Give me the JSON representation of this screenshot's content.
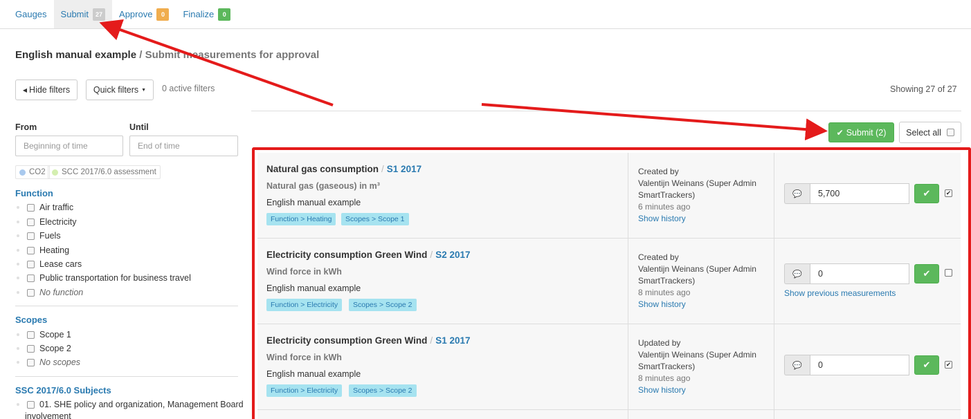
{
  "tabs": [
    {
      "label": "Gauges",
      "badge": ""
    },
    {
      "label": "Submit",
      "badge": "27",
      "badge_color": "#cccccc"
    },
    {
      "label": "Approve",
      "badge": "0",
      "badge_color": "#f0ad4e"
    },
    {
      "label": "Finalize",
      "badge": "0",
      "badge_color": "#5cb85c"
    }
  ],
  "page": {
    "title": "English manual example",
    "subtitle": "/ Submit measurements for approval"
  },
  "toolbar": {
    "hide_filters": "Hide filters",
    "quick_filters": "Quick filters",
    "active_filters": "0 active filters",
    "showing": "Showing 27 of 27",
    "submit": "Submit (2)",
    "select_all": "Select all"
  },
  "filters": {
    "from_label": "From",
    "until_label": "Until",
    "from_placeholder": "Beginning of time",
    "until_placeholder": "End of time",
    "tags": [
      {
        "label": "CO2",
        "color": "#a9c9ee"
      },
      {
        "label": "SCC 2017/6.0 assessment",
        "color": "#d4efb0"
      }
    ],
    "function_title": "Function",
    "function_items": [
      "Air traffic",
      "Electricity",
      "Fuels",
      "Heating",
      "Lease cars",
      "Public transportation for business travel",
      "No function"
    ],
    "scopes_title": "Scopes",
    "scope_items": [
      "Scope 1",
      "Scope 2",
      "No scopes"
    ],
    "ssc_title": "SSC 2017/6.0 Subjects",
    "ssc_item_line1": "01. SHE policy and organization, Management Board",
    "ssc_item_line2": "involvement"
  },
  "rows": [
    {
      "name": "Natural gas consumption",
      "period": "S1 2017",
      "unit": "Natural gas (gaseous) in m³",
      "project": "English manual example",
      "tag1": "Function > Heating",
      "tag2": "Scopes > Scope 1",
      "action": "Created by",
      "user1": "Valentijn Weinans (Super Admin",
      "user2": "SmartTrackers)",
      "time": "6 minutes ago",
      "history": "Show history",
      "value": "5,700",
      "checked": true,
      "prev": ""
    },
    {
      "name": "Electricity consumption Green Wind",
      "period": "S2 2017",
      "unit": "Wind force in kWh",
      "project": "English manual example",
      "tag1": "Function > Electricity",
      "tag2": "Scopes > Scope 2",
      "action": "Created by",
      "user1": "Valentijn Weinans (Super Admin",
      "user2": "SmartTrackers)",
      "time": "8 minutes ago",
      "history": "Show history",
      "value": "0",
      "checked": false,
      "prev": "Show previous measurements"
    },
    {
      "name": "Electricity consumption Green Wind",
      "period": "S1 2017",
      "unit": "Wind force in kWh",
      "project": "English manual example",
      "tag1": "Function > Electricity",
      "tag2": "Scopes > Scope 2",
      "action": "Updated by",
      "user1": "Valentijn Weinans (Super Admin",
      "user2": "SmartTrackers)",
      "time": "8 minutes ago",
      "history": "Show history",
      "value": "0",
      "checked": true,
      "prev": ""
    }
  ],
  "colors": {
    "accent": "#2a7ab0",
    "success": "#5cb85c",
    "highlight": "#e41b1b",
    "tag_bg": "#a6e3f0"
  }
}
